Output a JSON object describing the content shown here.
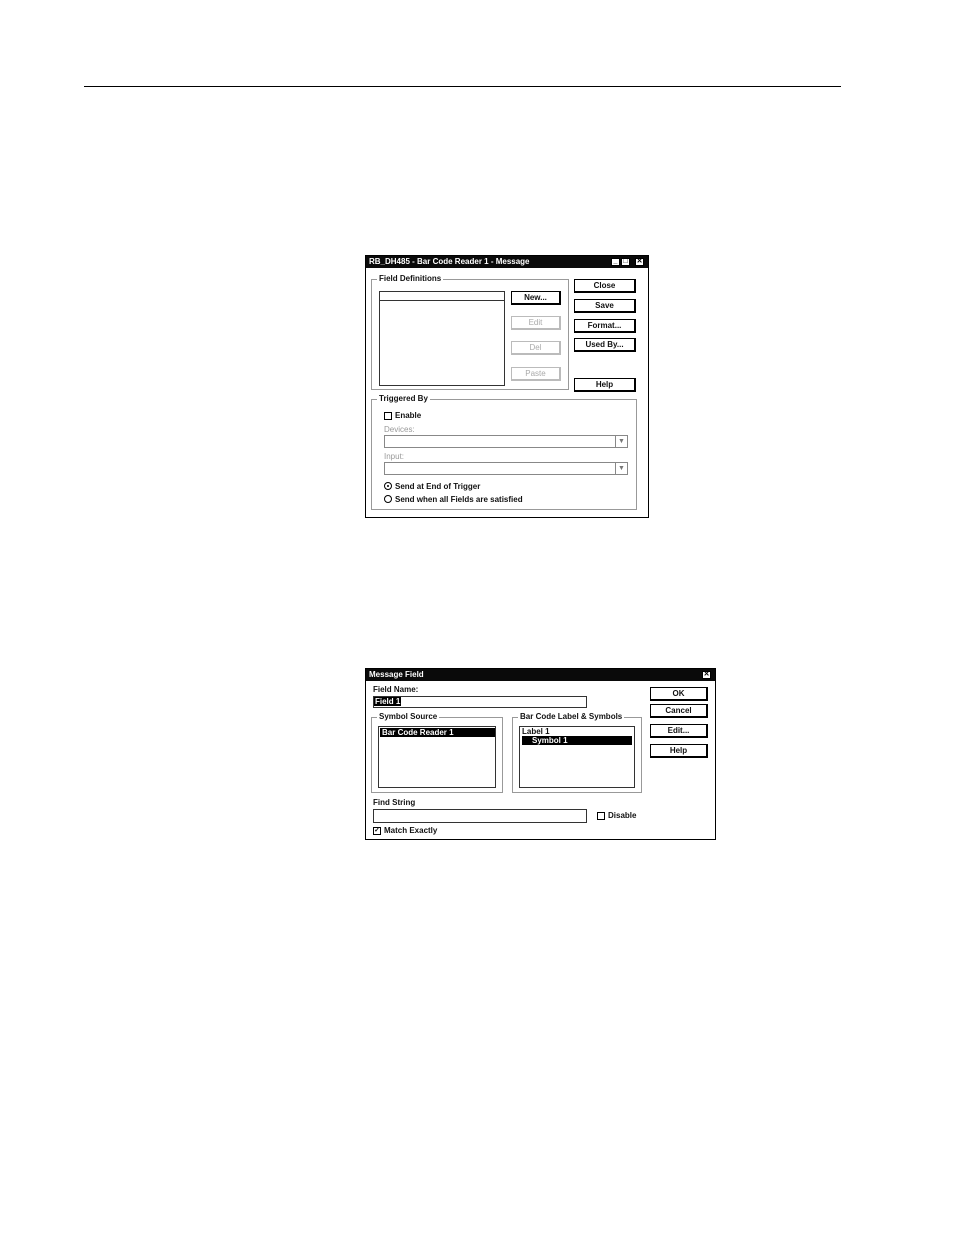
{
  "dialog1": {
    "title": "RB_DH485 - Bar Code Reader 1 - Message",
    "title_controls": [
      "_",
      "□",
      "✕"
    ],
    "field_definitions": {
      "legend": "Field Definitions",
      "buttons": {
        "new": "New...",
        "edit": "Edit",
        "del": "Del",
        "paste": "Paste"
      }
    },
    "side_buttons": {
      "close": "Close",
      "save": "Save",
      "format": "Format...",
      "used_by": "Used By...",
      "help": "Help"
    },
    "triggered_by": {
      "legend": "Triggered By",
      "enable_label": "Enable",
      "enable_checked": false,
      "devices_label": "Devices:",
      "devices_value": "",
      "input_label": "Input:",
      "input_value": "",
      "radio_end_of_trigger": "Send at End of Trigger",
      "radio_all_fields": "Send when all Fields are satisfied",
      "selected_radio": "end_of_trigger"
    }
  },
  "dialog2": {
    "title": "Message Field",
    "title_controls": [
      "✕"
    ],
    "field_name_label": "Field Name:",
    "field_name_value": "Field 1",
    "symbol_source": {
      "legend": "Symbol Source",
      "items": [
        "Bar Code Reader 1"
      ],
      "selected_index": 0
    },
    "bar_code_label": {
      "legend": "Bar Code Label & Symbols",
      "items": [
        "Label 1",
        "Symbol 1"
      ],
      "selected_index": 1
    },
    "buttons": {
      "ok": "OK",
      "cancel": "Cancel",
      "edit": "Edit...",
      "help": "Help"
    },
    "find_string_label": "Find String",
    "find_string_value": "",
    "disable_label": "Disable",
    "disable_checked": false,
    "match_exactly_label": "Match Exactly",
    "match_exactly_checked": true
  }
}
